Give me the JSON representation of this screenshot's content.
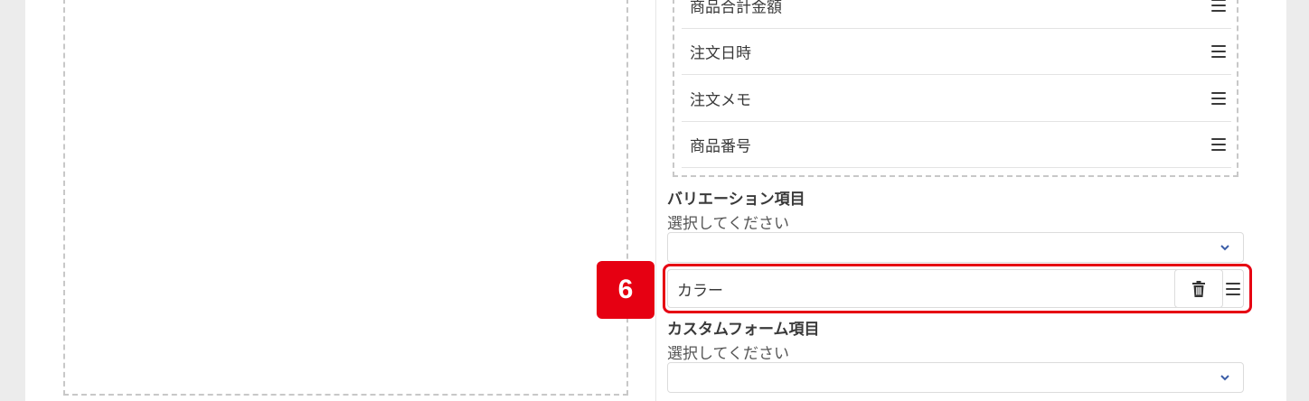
{
  "selected_fields": [
    {
      "label": "商品合計金額"
    },
    {
      "label": "注文日時"
    },
    {
      "label": "注文メモ"
    },
    {
      "label": "商品番号"
    }
  ],
  "variation_section": {
    "title": "バリエーション項目",
    "subtitle": "選択してください",
    "select_value": "",
    "added_items": [
      {
        "label": "カラー"
      }
    ]
  },
  "custom_form_section": {
    "title": "カスタムフォーム項目",
    "subtitle": "選択してください",
    "select_value": ""
  },
  "annotation": {
    "step_number": "6",
    "highlight_color": "#e60012"
  },
  "icons": {
    "drag": "drag-handle-icon",
    "trash": "trash-icon",
    "dropdown": "chevron-down-icon"
  },
  "colors": {
    "chevron": "#3b5ea8",
    "accent_red": "#e60012"
  }
}
